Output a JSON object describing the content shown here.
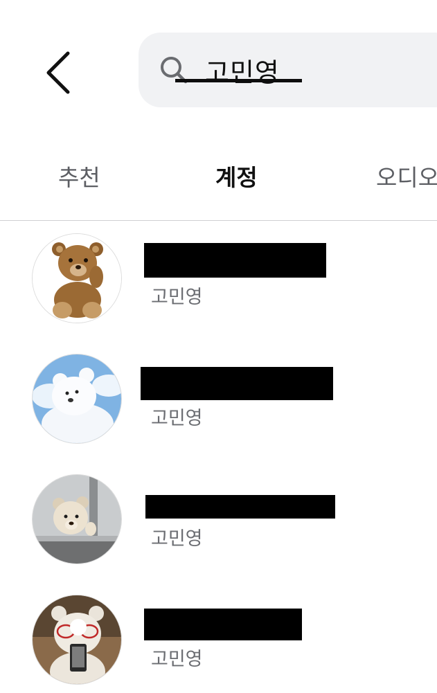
{
  "header": {
    "back_icon": "chevron-left-icon",
    "search": {
      "icon": "search-icon",
      "query": "고민영"
    }
  },
  "tabs": [
    {
      "label": "추천",
      "active": false
    },
    {
      "label": "계정",
      "active": true
    },
    {
      "label": "오디오",
      "active": false
    }
  ],
  "accounts": [
    {
      "username_redacted": true,
      "display_name": "고민영",
      "avatar": "teddy-bear-brown"
    },
    {
      "username_redacted": true,
      "display_name": "고민영",
      "avatar": "white-bear-clouds"
    },
    {
      "username_redacted": true,
      "display_name": "고민영",
      "avatar": "bear-at-window"
    },
    {
      "username_redacted": true,
      "display_name": "고민영",
      "avatar": "white-bear-phone"
    }
  ]
}
